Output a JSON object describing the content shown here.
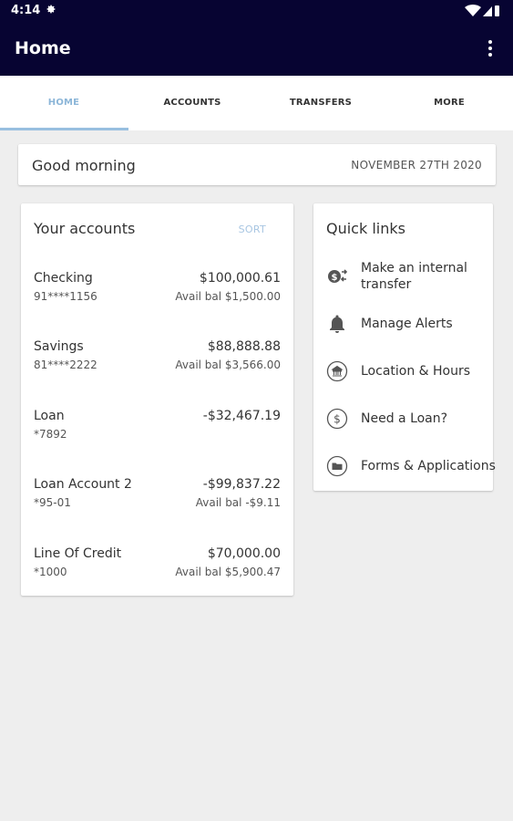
{
  "status_bar": {
    "time": "4:14"
  },
  "app_bar": {
    "title": "Home"
  },
  "tabs": [
    {
      "label": "HOME",
      "active": true
    },
    {
      "label": "ACCOUNTS",
      "active": false
    },
    {
      "label": "TRANSFERS",
      "active": false
    },
    {
      "label": "MORE",
      "active": false
    }
  ],
  "greeting": {
    "text": "Good morning",
    "date": "NOVEMBER 27TH 2020"
  },
  "accounts": {
    "heading": "Your accounts",
    "sort_label": "SORT",
    "items": [
      {
        "name": "Checking",
        "number": "91****1156",
        "balance": "$100,000.61",
        "available": "Avail bal $1,500.00"
      },
      {
        "name": "Savings",
        "number": "81****2222",
        "balance": "$88,888.88",
        "available": "Avail bal $3,566.00"
      },
      {
        "name": "Loan",
        "number": "*7892",
        "balance": "-$32,467.19",
        "available": ""
      },
      {
        "name": "Loan Account 2",
        "number": "*95-01",
        "balance": "-$99,837.22",
        "available": "Avail bal -$9.11"
      },
      {
        "name": "Line Of Credit",
        "number": "*1000",
        "balance": "$70,000.00",
        "available": "Avail bal $5,900.47"
      }
    ]
  },
  "quick_links": {
    "heading": "Quick links",
    "items": [
      {
        "label_line1": "Make an internal",
        "label_line2": "transfer",
        "icon": "transfer-icon"
      },
      {
        "label_line1": "Manage Alerts",
        "icon": "bell-icon"
      },
      {
        "label_line1": "Location & Hours",
        "icon": "bank-icon"
      },
      {
        "label_line1": "Need a Loan?",
        "icon": "dollar-icon"
      },
      {
        "label_line1": "Forms & Applications",
        "icon": "folder-icon"
      }
    ]
  },
  "colors": {
    "header_bg": "#070432",
    "accent": "#98bfe0",
    "page_bg": "#eeeeee"
  }
}
